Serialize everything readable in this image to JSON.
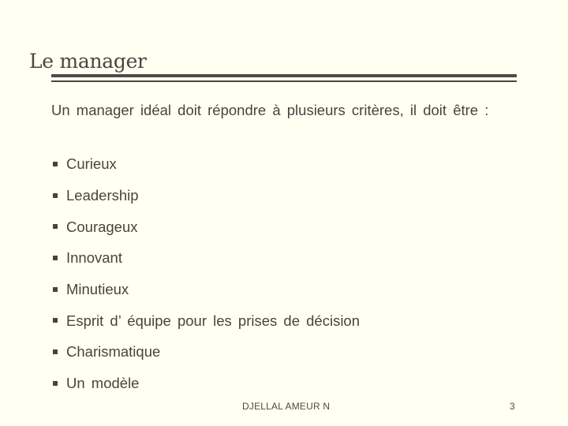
{
  "slide": {
    "title": "Le manager",
    "intro": "Un manager idéal doit répondre à plusieurs critères, il doit être :",
    "bullets": [
      "Curieux",
      "Leadership",
      "Courageux",
      "Innovant",
      "Minutieux",
      "Esprit d’ équipe pour les prises de décision",
      "Charismatique",
      "Un modèle"
    ],
    "bullet_icon": "square-bullet-icon"
  },
  "footer": {
    "author": "DJELLAL AMEUR N",
    "page_number": "3"
  },
  "colors": {
    "background": "#FFFFF2",
    "text": "#48443B",
    "rule": "#4F4A44"
  }
}
